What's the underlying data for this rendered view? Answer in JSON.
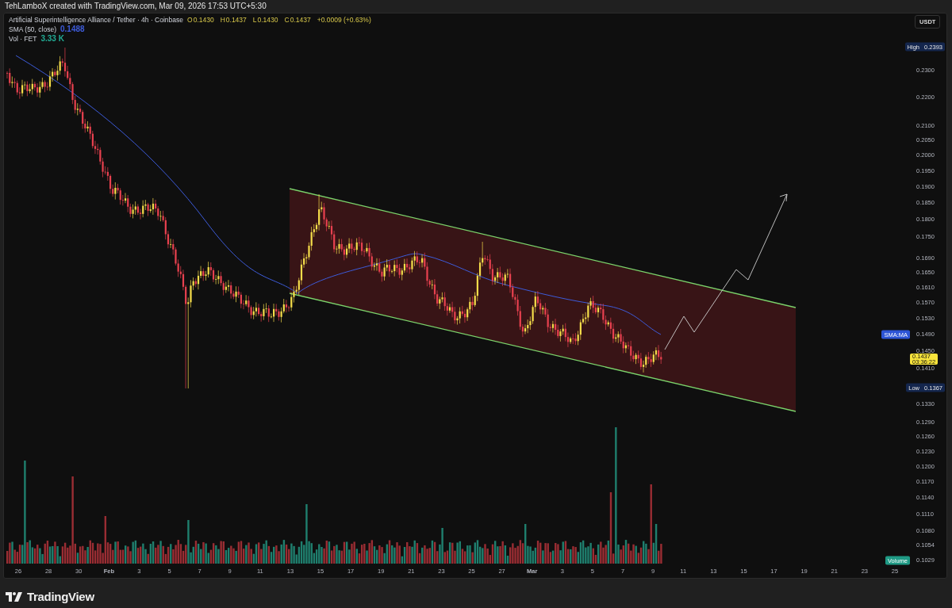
{
  "attribution": "TehLamboX created with TradingView.com, Mar 09, 2026 17:53 UTC+5:30",
  "legend": {
    "symbol": "Artificial Superintelligence Alliance / Tether · 4h · Coinbase",
    "ohlc": [
      {
        "label": "O",
        "value": "0.1430"
      },
      {
        "label": "H",
        "value": "0.1437"
      },
      {
        "label": "L",
        "value": "0.1430"
      },
      {
        "label": "C",
        "value": "0.1437"
      }
    ],
    "change": "+0.0009 (+0.63%)",
    "indicators": [
      {
        "name": "SMA (50, close)",
        "value": "0.1488",
        "color": "#3d5bd9"
      },
      {
        "name": "Vol · FET",
        "value": "3.33 K",
        "color": "#22ab94"
      }
    ]
  },
  "price_axis": {
    "currency": "USDT",
    "ticks": [
      {
        "label": "0.2300"
      },
      {
        "label": "0.2200"
      },
      {
        "label": "0.2100"
      },
      {
        "label": "0.2050"
      },
      {
        "label": "0.2000"
      },
      {
        "label": "0.1950"
      },
      {
        "label": "0.1900"
      },
      {
        "label": "0.1850"
      },
      {
        "label": "0.1800"
      },
      {
        "label": "0.1750"
      },
      {
        "label": "0.1690"
      },
      {
        "label": "0.1650"
      },
      {
        "label": "0.1610"
      },
      {
        "label": "0.1570"
      },
      {
        "label": "0.1530"
      },
      {
        "label": "0.1490",
        "tag": {
          "kind": "sma",
          "label": "SMA:MA"
        }
      },
      {
        "label": "0.1450"
      },
      {
        "label": "0.1410"
      },
      {
        "label": "0.1330"
      },
      {
        "label": "0.1290"
      },
      {
        "label": "0.1260"
      },
      {
        "label": "0.1230"
      },
      {
        "label": "0.1200"
      },
      {
        "label": "0.1170"
      },
      {
        "label": "0.1140"
      },
      {
        "label": "0.1110"
      },
      {
        "label": "0.1080"
      },
      {
        "label": "0.1054"
      },
      {
        "label": "0.1029",
        "tag": {
          "kind": "volume",
          "label": "Volume"
        }
      }
    ],
    "markers": [
      {
        "label": "High",
        "value": "0.2393"
      },
      {
        "label": "Low",
        "value": "0.1367"
      }
    ],
    "last_price": {
      "value": "0.1437",
      "countdown": "03:36:22"
    }
  },
  "time_axis": [
    {
      "label": "26",
      "kind": "day"
    },
    {
      "label": "28",
      "kind": "day"
    },
    {
      "label": "30",
      "kind": "day"
    },
    {
      "label": "Feb",
      "kind": "month"
    },
    {
      "label": "3",
      "kind": "day"
    },
    {
      "label": "5",
      "kind": "day"
    },
    {
      "label": "7",
      "kind": "day"
    },
    {
      "label": "9",
      "kind": "day"
    },
    {
      "label": "11",
      "kind": "day"
    },
    {
      "label": "13",
      "kind": "day"
    },
    {
      "label": "15",
      "kind": "day"
    },
    {
      "label": "17",
      "kind": "day"
    },
    {
      "label": "19",
      "kind": "day"
    },
    {
      "label": "21",
      "kind": "day"
    },
    {
      "label": "23",
      "kind": "day"
    },
    {
      "label": "25",
      "kind": "day"
    },
    {
      "label": "27",
      "kind": "day"
    },
    {
      "label": "Mar",
      "kind": "month"
    },
    {
      "label": "3",
      "kind": "day"
    },
    {
      "label": "5",
      "kind": "day"
    },
    {
      "label": "7",
      "kind": "day"
    },
    {
      "label": "9",
      "kind": "day"
    },
    {
      "label": "11",
      "kind": "day"
    },
    {
      "label": "13",
      "kind": "day"
    },
    {
      "label": "15",
      "kind": "day"
    },
    {
      "label": "17",
      "kind": "day"
    },
    {
      "label": "19",
      "kind": "day"
    },
    {
      "label": "21",
      "kind": "day"
    },
    {
      "label": "23",
      "kind": "day"
    },
    {
      "label": "25",
      "kind": "day"
    }
  ],
  "footer": {
    "brand": "TradingView"
  }
}
